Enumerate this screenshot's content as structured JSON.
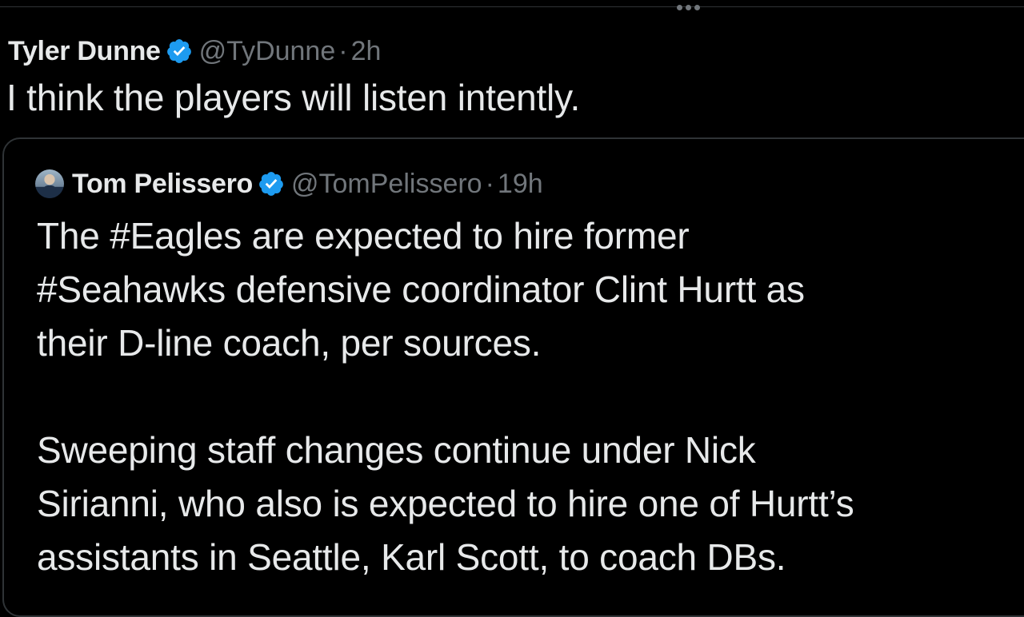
{
  "tweet": {
    "display_name": "Tyler Dunne",
    "handle": "@TyDunne",
    "separator": "·",
    "time": "2h",
    "text": "I think the players will listen intently."
  },
  "quoted_tweet": {
    "display_name": "Tom Pelissero",
    "handle": "@TomPelissero",
    "separator": "·",
    "time": "19h",
    "paragraphs": [
      "The #Eagles are expected to hire former\n#Seahawks defensive coordinator Clint Hurtt as\ntheir D-line coach, per sources.",
      "Sweeping staff changes continue under Nick\nSirianni, who also is expected to hire one of Hurtt’s\nassistants in Seattle, Karl Scott, to coach DBs."
    ]
  },
  "icons": {
    "verified": "verified-badge-icon",
    "more": "more-horizontal-icon"
  },
  "colors": {
    "background": "#000000",
    "text_primary": "#e7e9ea",
    "text_secondary": "#71767b",
    "verified_blue": "#1d9bf0",
    "border": "#2f3336"
  }
}
